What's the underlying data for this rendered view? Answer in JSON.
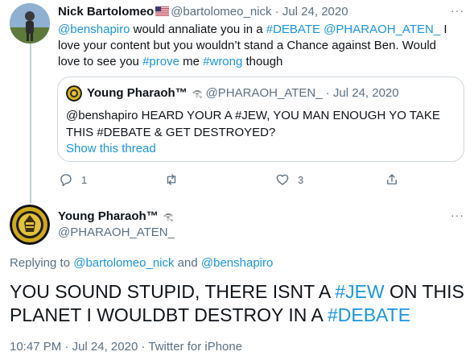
{
  "tweet1": {
    "name": "Nick Bartolomeo",
    "flag_icon": "us-flag-icon",
    "handle": "@bartolomeo_nick",
    "sep": " · ",
    "date": "Jul 24, 2020",
    "body": {
      "m1": "@benshapiro",
      "t1": " would annaliate you in a ",
      "h1": "#DEBATE",
      "t2": " ",
      "m2": "@PHARAOH_ATEN_",
      "t3": " I love your content but you wouldn’t stand a Chance against Ben. Would love to see you ",
      "h2": "#prove",
      "t4": " me ",
      "h3": "#wrong",
      "t5": " though"
    },
    "more": "···",
    "quote": {
      "name": "Young Pharaoh™",
      "glyph": "𓂀",
      "handle": "@PHARAOH_ATEN_",
      "sep": " · ",
      "date": "Jul 24, 2020",
      "body": "@benshapiro HEARD YOUR A #JEW, YOU MAN ENOUGH YO TAKE THIS #DEBATE & GET DESTROYED?",
      "show_thread": "Show this thread"
    },
    "actions": {
      "reply_count": "1",
      "like_count": "3"
    }
  },
  "tweet2": {
    "name": "Young Pharaoh™",
    "glyph": "𓂀",
    "handle": "@PHARAOH_ATEN_",
    "more": "···",
    "replying_prefix": "Replying to ",
    "replying_user1": "@bartolomeo_nick",
    "replying_and": " and ",
    "replying_user2": "@benshapiro",
    "body": {
      "t1": "YOU SOUND STUPID, THERE ISNT A ",
      "h1": "#JEW",
      "t2": " ON THIS PLANET I WOULDBT DESTROY IN A ",
      "h2": "#DEBATE"
    },
    "time": "10:47 PM",
    "date": "Jul 24, 2020",
    "sep": " · ",
    "source": "Twitter for iPhone"
  },
  "colors": {
    "link": "#1b95e0",
    "muted": "#5b7083",
    "text": "#0f1419",
    "border": "#cfd9de"
  }
}
